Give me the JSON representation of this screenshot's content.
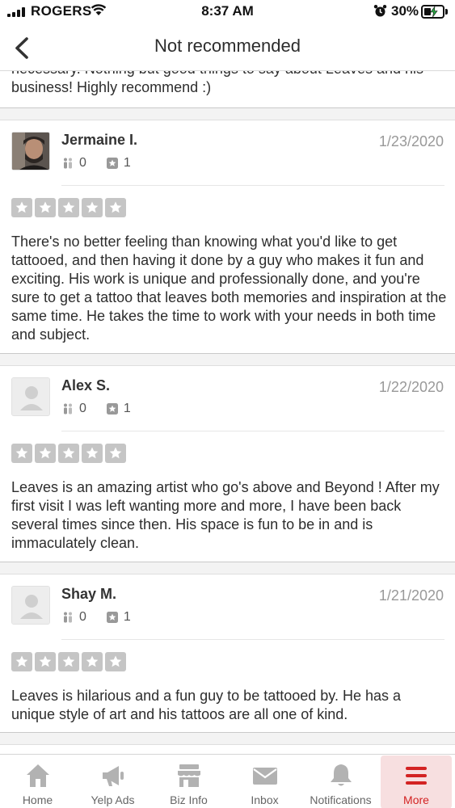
{
  "status_bar": {
    "carrier": "ROGERS",
    "time": "8:37 AM",
    "battery": "30%"
  },
  "nav": {
    "title": "Not recommended"
  },
  "feed": {
    "previous_review_tail": "necessary. Nothing but good things to say about Leaves and his business! Highly recommend :)",
    "reviews": [
      {
        "name": "Jermaine I.",
        "date": "1/23/2020",
        "friends": "0",
        "reviews_count": "1",
        "rating": 5,
        "text": "There's no better feeling than knowing what you'd like to get tattooed, and then having it done by a guy who makes it fun and exciting. His work is unique and professionally done, and you're sure to get a tattoo that leaves both memories and inspiration at the same time. He takes the time to work with your needs in both time and subject."
      },
      {
        "name": "Alex S.",
        "date": "1/22/2020",
        "friends": "0",
        "reviews_count": "1",
        "rating": 5,
        "text": "Leaves is an amazing artist who go's above and Beyond ! After my first visit I was left wanting more and more, I have been back several times since then.  His space is fun to be in and is immaculately clean."
      },
      {
        "name": "Shay M.",
        "date": "1/21/2020",
        "friends": "0",
        "reviews_count": "1",
        "rating": 5,
        "text": "Leaves is hilarious and a fun guy to be tattooed by. He has a unique style of art and his tattoos are all one of kind."
      }
    ]
  },
  "tab_bar": {
    "active_color": "#d32323",
    "tabs": [
      {
        "label": "Home",
        "icon": "home-icon"
      },
      {
        "label": "Yelp Ads",
        "icon": "megaphone-icon"
      },
      {
        "label": "Biz Info",
        "icon": "storefront-icon"
      },
      {
        "label": "Inbox",
        "icon": "envelope-icon"
      },
      {
        "label": "Notifications",
        "icon": "bell-icon"
      },
      {
        "label": "More",
        "icon": "hamburger-menu-icon"
      }
    ]
  }
}
